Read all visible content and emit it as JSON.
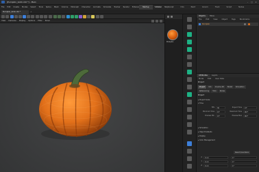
{
  "window": {
    "title": "[Pumpkin_Gilot.c4d *] - Main"
  },
  "menu": {
    "items": [
      "File",
      "Edit",
      "Create",
      "Modes",
      "Select",
      "Tools",
      "Spline",
      "Mesh",
      "Volume",
      "MoGraph",
      "Character",
      "Animate",
      "Simulate",
      "Tracker",
      "Render",
      "Extensions",
      "Redshift",
      "Window",
      "Help"
    ]
  },
  "layouts": {
    "tabs": [
      "Startup",
      "Model",
      "Sculpt",
      "UVs",
      "Paint",
      "Groom",
      "Track",
      "Script",
      "Nodes"
    ],
    "active": 0
  },
  "document": {
    "tab_label": "Pumpkin_Gilot.c4d *"
  },
  "viewport_menu": {
    "items": [
      "View",
      "Cameras",
      "Display",
      "Options",
      "Filter",
      "Panel"
    ]
  },
  "material": {
    "name": "Pumpkin"
  },
  "objects_panel": {
    "tabs": [
      "Objects",
      "Takes"
    ],
    "menu": [
      "File",
      "Edit",
      "View",
      "Object",
      "Tags",
      "Bookmarks"
    ],
    "rows": [
      {
        "name": "Pumpkin"
      }
    ]
  },
  "attributes_panel": {
    "tabs": [
      "Attributes",
      "Layers"
    ],
    "menu": [
      "Mode",
      "Edit",
      "User Data"
    ],
    "project_label": "Project",
    "buttons": [
      "Project",
      "Info",
      "Cinema 4D",
      "Bullet",
      "Simulation",
      "Referencing",
      "Todo",
      "Nodes"
    ],
    "section_title": "Project",
    "sections": {
      "scale": "Project Scale",
      "time": "Time",
      "simulation": "Simulation",
      "object_defaults": "Object Defaults",
      "display": "Display",
      "color_management": "Color Management"
    },
    "fields": {
      "fps_label": "FPS",
      "fps_value": "30",
      "project_time_label": "Project Time",
      "project_time_value": "0 F",
      "min_time_label": "Minimum Time",
      "min_time_value": "0 F",
      "max_time_label": "Maximum Time",
      "max_time_value": "90 F",
      "preview_min_label": "Preview Min",
      "preview_min_value": "0 F",
      "preview_max_label": "Preview Max",
      "preview_max_value": "90 F"
    },
    "reset_button": "Reset Quantizers",
    "bottom_rows": [
      {
        "label": "X",
        "value": "0 cm",
        "value2": "0 °"
      },
      {
        "label": "Y",
        "value": "0 cm",
        "value2": "0 °"
      },
      {
        "label": "Z",
        "value": "0 cm",
        "value2": "0 °"
      }
    ]
  },
  "colors": {
    "accent_teal": "#1db184",
    "accent_blue": "#3d7fd9",
    "pumpkin_orange": "#e2701a",
    "stem_green": "#4d6a3a"
  }
}
